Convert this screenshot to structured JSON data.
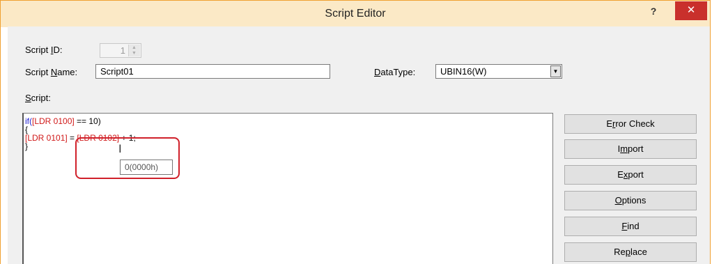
{
  "window": {
    "title": "Script Editor",
    "help_label": "?",
    "close_label": "✕"
  },
  "form": {
    "script_id": {
      "label_pre": "Script ",
      "label_key": "I",
      "label_post": "D:",
      "value": "1"
    },
    "script_name": {
      "label_pre": "Script ",
      "label_key": "N",
      "label_post": "ame:",
      "value": "Script01"
    },
    "data_type": {
      "label_key": "D",
      "label_post": "ataType:",
      "value": "UBIN16(W)"
    },
    "script": {
      "label_key": "S",
      "label_post": "cript:"
    }
  },
  "editor": {
    "lines": [
      [
        {
          "t": "if(",
          "c": "blue"
        },
        {
          "t": "[LDR 0100]",
          "c": "red"
        },
        {
          "t": " == 10)",
          "c": "black"
        }
      ],
      [
        {
          "t": "{",
          "c": "black"
        }
      ],
      [
        {
          "t": "[LDR 0101]",
          "c": "red"
        },
        {
          "t": " = ",
          "c": "black"
        },
        {
          "t": "[LDR 0102]",
          "c": "red"
        },
        {
          "t": " + 1;",
          "c": "black"
        }
      ],
      [
        {
          "t": "}",
          "c": "black"
        }
      ]
    ],
    "tooltip": "0(0000h)",
    "highlight_color": "#d0202a"
  },
  "buttons": [
    {
      "pre": "E",
      "key": "r",
      "post": "ror Check"
    },
    {
      "pre": "I",
      "key": "m",
      "post": "port"
    },
    {
      "pre": "E",
      "key": "x",
      "post": "port"
    },
    {
      "pre": "",
      "key": "O",
      "post": "ptions"
    },
    {
      "pre": "",
      "key": "F",
      "post": "ind"
    },
    {
      "pre": "Re",
      "key": "p",
      "post": "lace"
    }
  ],
  "colors": {
    "title_bar": "#fbe9c6",
    "close_button": "#c9302c",
    "keyword": "#1a1ad0",
    "register": "#d01818"
  }
}
